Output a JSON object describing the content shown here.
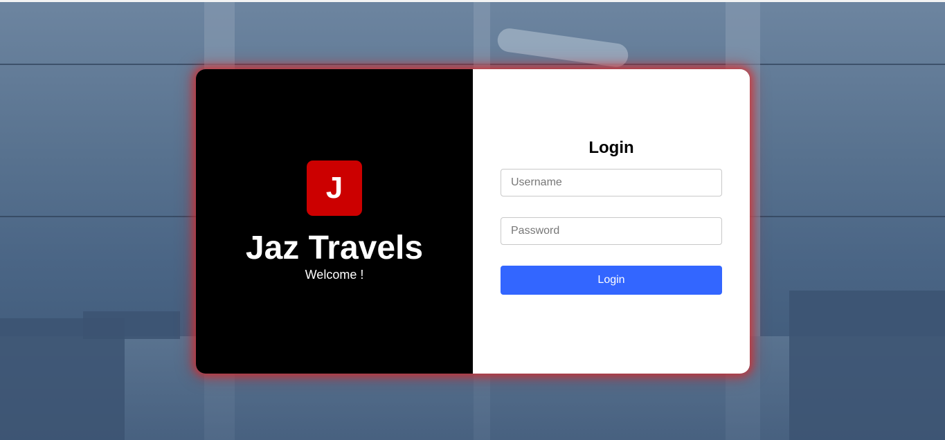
{
  "brand": {
    "logo_letter": "J",
    "name": "Jaz Travels",
    "welcome": "Welcome !",
    "logo_color": "#cc0000"
  },
  "login": {
    "title": "Login",
    "username_placeholder": "Username",
    "password_placeholder": "Password",
    "submit_label": "Login",
    "button_color": "#3366ff"
  }
}
